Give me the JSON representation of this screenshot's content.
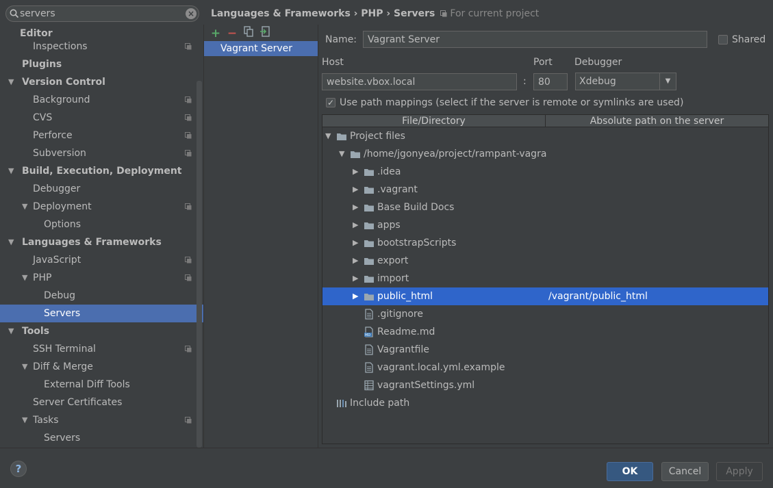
{
  "search": {
    "value": "servers"
  },
  "tree": [
    {
      "label": "Editor",
      "bold": true,
      "indent": 0,
      "arrow": "",
      "proj": false
    },
    {
      "label": "Inspections",
      "bold": false,
      "indent": 1,
      "arrow": "",
      "proj": true
    },
    {
      "label": "Plugins",
      "bold": true,
      "indent": 0,
      "arrow": "",
      "proj": false
    },
    {
      "label": "Version Control",
      "bold": true,
      "indent": 0,
      "arrow": "▼",
      "proj": false
    },
    {
      "label": "Background",
      "bold": false,
      "indent": 1,
      "arrow": "",
      "proj": true
    },
    {
      "label": "CVS",
      "bold": false,
      "indent": 1,
      "arrow": "",
      "proj": true
    },
    {
      "label": "Perforce",
      "bold": false,
      "indent": 1,
      "arrow": "",
      "proj": true
    },
    {
      "label": "Subversion",
      "bold": false,
      "indent": 1,
      "arrow": "",
      "proj": true
    },
    {
      "label": "Build, Execution, Deployment",
      "bold": true,
      "indent": 0,
      "arrow": "▼",
      "proj": false
    },
    {
      "label": "Debugger",
      "bold": false,
      "indent": 1,
      "arrow": "",
      "proj": false
    },
    {
      "label": "Deployment",
      "bold": false,
      "indent": 1,
      "arrow": "▼",
      "proj": true
    },
    {
      "label": "Options",
      "bold": false,
      "indent": 2,
      "arrow": "",
      "proj": false
    },
    {
      "label": "Languages & Frameworks",
      "bold": true,
      "indent": 0,
      "arrow": "▼",
      "proj": false
    },
    {
      "label": "JavaScript",
      "bold": false,
      "indent": 1,
      "arrow": "",
      "proj": true
    },
    {
      "label": "PHP",
      "bold": false,
      "indent": 1,
      "arrow": "▼",
      "proj": true
    },
    {
      "label": "Debug",
      "bold": false,
      "indent": 2,
      "arrow": "",
      "proj": false
    },
    {
      "label": "Servers",
      "bold": false,
      "indent": 2,
      "arrow": "",
      "proj": false,
      "selected": true
    },
    {
      "label": "Tools",
      "bold": true,
      "indent": 0,
      "arrow": "▼",
      "proj": false
    },
    {
      "label": "SSH Terminal",
      "bold": false,
      "indent": 1,
      "arrow": "",
      "proj": true
    },
    {
      "label": "Diff & Merge",
      "bold": false,
      "indent": 1,
      "arrow": "▼",
      "proj": false
    },
    {
      "label": "External Diff Tools",
      "bold": false,
      "indent": 2,
      "arrow": "",
      "proj": false
    },
    {
      "label": "Server Certificates",
      "bold": false,
      "indent": 1,
      "arrow": "",
      "proj": false
    },
    {
      "label": "Tasks",
      "bold": false,
      "indent": 1,
      "arrow": "▼",
      "proj": true
    },
    {
      "label": "Servers",
      "bold": false,
      "indent": 2,
      "arrow": "",
      "proj": false
    }
  ],
  "breadcrumb": {
    "path": "Languages & Frameworks › PHP › Servers",
    "scope": "For current project"
  },
  "servers": {
    "items": [
      "Vagrant Server"
    ]
  },
  "form": {
    "name_label": "Name:",
    "name_value": "Vagrant Server",
    "shared_label": "Shared",
    "host_label": "Host",
    "host_value": "website.vbox.local",
    "colon": ":",
    "port_label": "Port",
    "port_value": "80",
    "debugger_label": "Debugger",
    "debugger_value": "Xdebug",
    "path_mappings_label": "Use path mappings (select if the server is remote or symlinks are used)"
  },
  "mapping": {
    "col1": "File/Directory",
    "col2": "Absolute path on the server",
    "rows": [
      {
        "label": "Project files",
        "indent": 0,
        "arrow": "▼",
        "icon": "folder-icon",
        "server": ""
      },
      {
        "label": "/home/jgonyea/project/rampant-vagra",
        "indent": 1,
        "arrow": "▼",
        "icon": "folder-icon",
        "server": ""
      },
      {
        "label": ".idea",
        "indent": 2,
        "arrow": "▶",
        "icon": "folder-icon",
        "server": ""
      },
      {
        "label": ".vagrant",
        "indent": 2,
        "arrow": "▶",
        "icon": "folder-icon",
        "server": ""
      },
      {
        "label": "Base Build Docs",
        "indent": 2,
        "arrow": "▶",
        "icon": "folder-icon",
        "server": ""
      },
      {
        "label": "apps",
        "indent": 2,
        "arrow": "▶",
        "icon": "folder-icon",
        "server": ""
      },
      {
        "label": "bootstrapScripts",
        "indent": 2,
        "arrow": "▶",
        "icon": "folder-icon",
        "server": ""
      },
      {
        "label": "export",
        "indent": 2,
        "arrow": "▶",
        "icon": "folder-icon",
        "server": ""
      },
      {
        "label": "import",
        "indent": 2,
        "arrow": "▶",
        "icon": "folder-icon",
        "server": ""
      },
      {
        "label": "public_html",
        "indent": 2,
        "arrow": "▶",
        "icon": "folder-icon",
        "server": "/vagrant/public_html",
        "selected": true
      },
      {
        "label": ".gitignore",
        "indent": 2,
        "arrow": "",
        "icon": "file-icon",
        "server": ""
      },
      {
        "label": "Readme.md",
        "indent": 2,
        "arrow": "",
        "icon": "markdown-file-icon",
        "server": ""
      },
      {
        "label": "Vagrantfile",
        "indent": 2,
        "arrow": "",
        "icon": "file-icon",
        "server": ""
      },
      {
        "label": "vagrant.local.yml.example",
        "indent": 2,
        "arrow": "",
        "icon": "file-icon",
        "server": ""
      },
      {
        "label": "vagrantSettings.yml",
        "indent": 2,
        "arrow": "",
        "icon": "yaml-file-icon",
        "server": ""
      },
      {
        "label": "Include path",
        "indent": 0,
        "arrow": "",
        "icon": "library-icon",
        "server": ""
      }
    ]
  },
  "buttons": {
    "help": "?",
    "ok": "OK",
    "cancel": "Cancel",
    "apply": "Apply"
  },
  "colors": {
    "selection": "#4b6eaf",
    "table_selection": "#2f65ca",
    "add_green": "#59a869",
    "remove_red": "#c75450"
  }
}
